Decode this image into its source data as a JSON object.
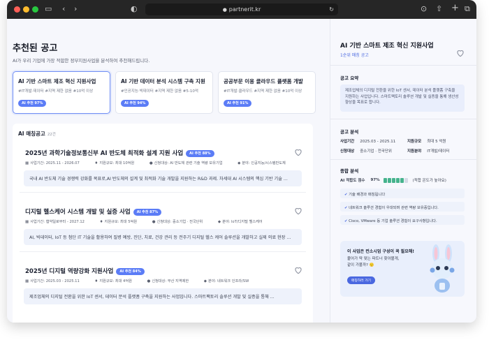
{
  "browser": {
    "url": "partnerit.kr"
  },
  "page": {
    "title": "추천된 공고",
    "subtitle": "AI가 우리 기업에 가장 적합한 정부지원사업을 분석하여 추천해드립니다."
  },
  "recommended": [
    {
      "title": "AI 기반 스마트 제조 혁신 지원사업",
      "tags": "#IT개발·데이터  #지역 제한 없음  #10억 이상",
      "badge": "AI 추천 97%"
    },
    {
      "title": "AI 기반 데이터 분석 시스템 구축 지원",
      "tags": "#인공지능·빅데이터  #지역 제한 없음  #5-10억",
      "badge": "AI 추천 94%"
    },
    {
      "title": "공공부문 이용 클라우드 플랫폼 개발",
      "tags": "#IT개발·클라우드  #지역 제한 없음  #10억 이상",
      "badge": "AI 추천 91%"
    }
  ],
  "list": {
    "heading": "AI 매칭공고",
    "count": "22건",
    "items": [
      {
        "title": "2025년 과학기술정보통신부 AI 반도체 최적화 설계 지원 사업",
        "badge": "AI 추천 88%",
        "period": "사업기간: 2025.11 - 2026.07",
        "scale": "지원규모: 최대 10억원",
        "target": "신청대상: AI 반도체 관련 기술 역량 보유기업",
        "field": "분야: 인공지능/시스템반도체",
        "desc": "국내 AI 반도체 기술 경쟁력 강화를 목표로,AI 반도체의 설계 및 최적화 기술 개발을 지원하는 R&D 과제. 차세대 AI 시스템의 핵심 기반 기술 ..."
      },
      {
        "title": "디지털 헬스케어 시스템 개발 및 실증 사업",
        "badge": "AI 추천 87%",
        "period": "사업기간: 협약일로부터 - 2027.12",
        "scale": "지원규모: 최대 5억원",
        "target": "신청대상: 중소기업 · 전국단위",
        "field": "분야: IoT/디지털 헬스케어",
        "desc": "AI, 빅데이터, IoT 등 첨단 IT 기술을 활용하여 질병 예방, 진단, 치료, 건강 관리 등 전주기 디지털 헬스 케어 솔루션을 개발하고 실제 의료 현장 ..."
      },
      {
        "title": "2025년 디지털 역량강화 지원사업",
        "badge": "AI 추천 84%",
        "period": "사업기간: 2025.03 - 2025.11",
        "scale": "지원규모: 최대 4억원",
        "target": "신청대상: 부산 지역제한",
        "field": "분야: 네트워크 인프라/SW",
        "desc": "제조업체의 디지털 전환을 위한 IoT 센서, 데이터 분석 플랫폼 구축을 지원하는 사업입니다. 스마트팩토리 솔루션 개발 및 실증을 통해 ..."
      }
    ]
  },
  "detail": {
    "title": "AI 기반 스마트 제조 혁신 지원사업",
    "rank": "1순위 매칭 공고",
    "summary_label": "공고 요약",
    "summary": "제조업체의 디지털 전환을 위한 IoT 센서, 데이터 분석 플랫폼 구축을 지원하는 사업입니다. 스마트팩토리 솔루션 개발 및 실증을 통해 생산성 향상을 목표로 합니다.",
    "analysis_label": "공고 분석",
    "period_k": "사업기간",
    "period_v": "2025.03 - 2025.11",
    "scale_k": "지원규모",
    "scale_v": "최대 5 억원",
    "target_k": "신청대상",
    "target_v": "중소기업 · 전국단위",
    "field_k": "지원분야",
    "field_v": "IT개발/데이터",
    "overall_label": "종합 분석",
    "score_label": "AI 적합도 점수",
    "score_value": "97%",
    "score_fraction": 0.97,
    "score_note": "(적합 온도가 높아요)",
    "checks": [
      "기술 배경과 매칭됩니다",
      "네트워크 솔루션 경험이 우대되며 관련 역량 보유중입니다.",
      "Cisco, VMware 등 기업 솔루션 경험이 요구사항입니다."
    ],
    "cta_title": "이 사업은 컨소시엄 구성이 꼭 필요해!",
    "cta_body": "붙어가 딱 맞는 파트너 찾아볼게, 같이 가볼까? 🙂",
    "cta_button": "매칭하러 가기"
  },
  "colors": {
    "accent": "#5b7cf6",
    "score": "#46b38d",
    "bar_off": "#d5dbe6"
  }
}
